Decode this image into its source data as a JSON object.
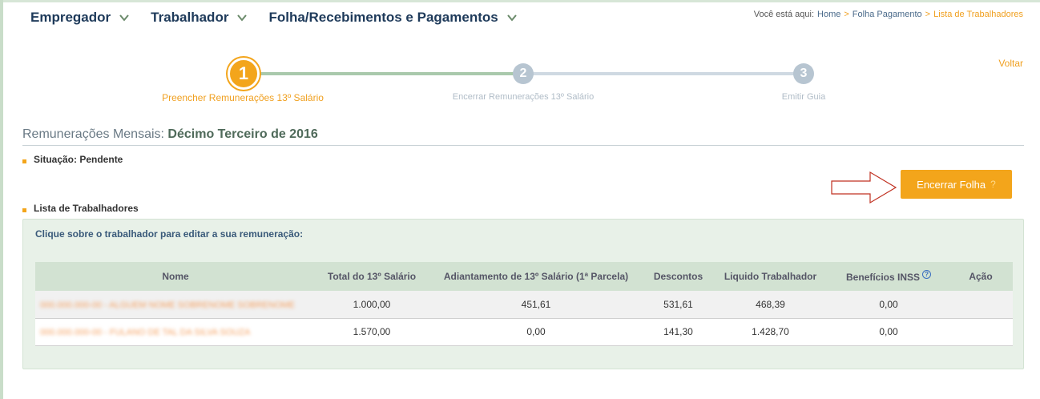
{
  "nav": {
    "items": [
      {
        "label": "Empregador"
      },
      {
        "label": "Trabalhador"
      },
      {
        "label": "Folha/Recebimentos e Pagamentos"
      }
    ]
  },
  "breadcrumb": {
    "prefix": "Você está aqui:",
    "home": "Home",
    "sep": ">",
    "folha": "Folha Pagamento",
    "current": "Lista de Trabalhadores"
  },
  "voltar": "Voltar",
  "stepper": {
    "steps": [
      {
        "number": "1",
        "label": "Preencher Remunerações 13º Salário",
        "state": "active"
      },
      {
        "number": "2",
        "label": "Encerrar Remunerações 13º Salário",
        "state": "inactive"
      },
      {
        "number": "3",
        "label": "Emitir Guia",
        "state": "inactive"
      }
    ]
  },
  "section": {
    "prefix": "Remunerações Mensais:",
    "title": "Décimo Terceiro de 2016"
  },
  "situacao": "Situação: Pendente",
  "encerrar_button": {
    "label": "Encerrar Folha",
    "help": "?"
  },
  "lista_title": "Lista de Trabalhadores",
  "panel": {
    "hint": "Clique sobre o trabalhador para editar a sua remuneração:"
  },
  "table": {
    "headers": [
      "Nome",
      "Total do 13º Salário",
      "Adiantamento de 13º Salário (1ª Parcela)",
      "Descontos",
      "Liquido Trabalhador",
      "Benefícios INSS",
      "Ação"
    ],
    "info_icon": "?",
    "rows": [
      {
        "name": "000.000.000-00 - ALGUEM NOME SOBRENOME SOBRENOME",
        "total": "1.000,00",
        "adiantamento": "451,61",
        "descontos": "531,61",
        "liquido": "468,39",
        "beneficios": "0,00",
        "acao": ""
      },
      {
        "name": "000.000.000-00 - FULANO DE TAL DA SILVA SOUZA",
        "total": "1.570,00",
        "adiantamento": "0,00",
        "descontos": "141,30",
        "liquido": "1.428,70",
        "beneficios": "0,00",
        "acao": ""
      }
    ]
  },
  "colors": {
    "accent": "#f3a51b",
    "nav_text": "#1e3a5a",
    "panel_bg": "#e8f1e8"
  }
}
